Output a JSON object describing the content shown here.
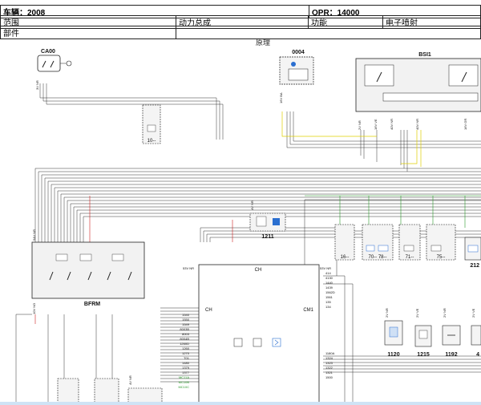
{
  "header": {
    "vehicle_label": "车辆：2008",
    "opr_label": "OPR：14000",
    "scope_label": "范围",
    "scope_value": "动力总成",
    "function_label": "功能",
    "function_value": "电子喷射",
    "part_label": "部件"
  },
  "diagram": {
    "title": "原理",
    "components": {
      "ca00": "CA00",
      "c0004": "0004",
      "bsi1": "BSI1",
      "c10": "10--",
      "c1211": "1211",
      "bfrm": "BFRM",
      "ch_top": "CH",
      "ch_left": "CH",
      "cm1": "CM1",
      "c16": "16--",
      "c70": "70-- 78--",
      "c71": "71--",
      "c75": "75--",
      "c212": "212",
      "c1120": "1120",
      "c1215": "1215",
      "c1192": "1192",
      "c4x": "4"
    },
    "connectors": {
      "ca00": "3V NR",
      "c0004": "16V BA",
      "bsi1_a": "2V NR",
      "bsi1_b": "16V VE",
      "bsi1_c": "40V NR",
      "bsi1_d": "40V NR",
      "bsi1_e": "16V GR",
      "bfrm_top": "54V NR",
      "bfrm_bottom": "10V NO",
      "c1211": "4V NR",
      "ecu_left": "53V NR",
      "ecu_right": "53V NR",
      "c1120": "2V NR",
      "c1215": "2V VE",
      "c1192": "2V NR",
      "c4x": "2V VE",
      "bottom_a": "4V NR"
    },
    "ecu_left_wires": [
      "1540",
      "1550",
      "1549",
      "8003B",
      "8003",
      "8004B",
      "1260D",
      "1260",
      "1270",
      "T01",
      "1480",
      "1379",
      "1377",
      "MC11A",
      "MC10B",
      "MC10C"
    ],
    "ecu_right_wires": [
      "414",
      "4130",
      "1440",
      "1439",
      "1562D",
      "1561",
      "135",
      "134"
    ],
    "ecu_lower_right_wires": [
      "1180A",
      "1324",
      "1323",
      "1322",
      "1321",
      "1500"
    ]
  }
}
